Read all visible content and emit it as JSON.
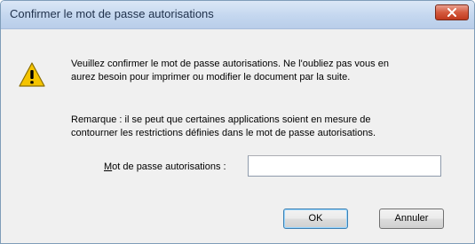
{
  "window": {
    "title": "Confirmer le mot de passe autorisations"
  },
  "icons": {
    "close": "close-icon",
    "warning": "warning-icon"
  },
  "message": {
    "line1": "Veuillez confirmer le mot de passe autorisations. Ne l'oubliez pas vous en",
    "line2": "aurez besoin pour imprimer ou modifier le document par la suite."
  },
  "remark": {
    "line1": "Remarque : il se peut que certaines applications soient en mesure de",
    "line2": "contourner les restrictions définies dans le mot de passe autorisations."
  },
  "field": {
    "label_accel": "M",
    "label_rest": "ot de passe autorisations :",
    "value": ""
  },
  "buttons": {
    "ok": "OK",
    "cancel": "Annuler"
  },
  "colors": {
    "close_button": "#c03a1e",
    "warning_fill": "#f5c400"
  }
}
